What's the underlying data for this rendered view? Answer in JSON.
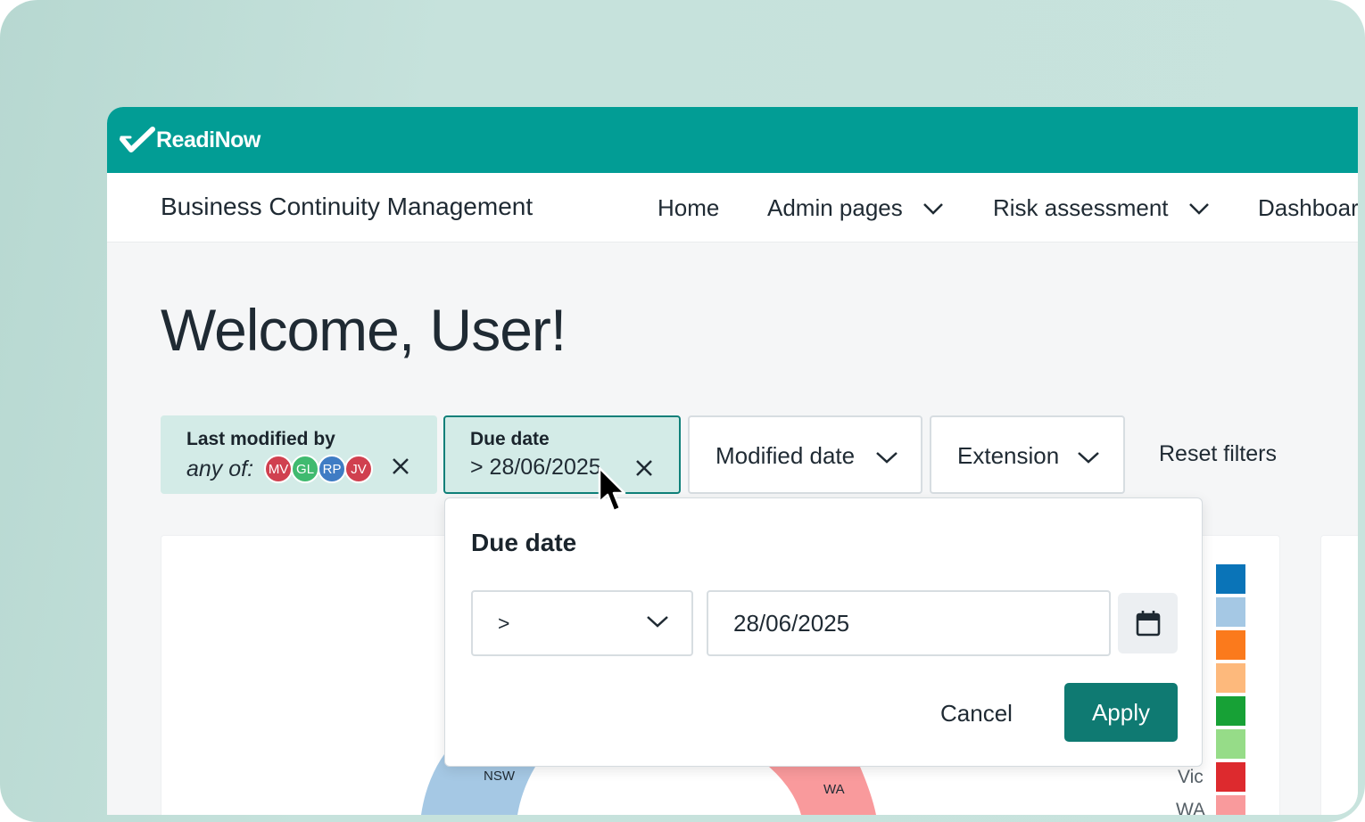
{
  "brand": {
    "name": "ReadiNow",
    "primary_color": "#029d95",
    "accent_color": "#0f7a72"
  },
  "app": {
    "title": "Business Continuity Management"
  },
  "nav": {
    "home": "Home",
    "admin": "Admin pages",
    "risk": "Risk assessment",
    "dashboard": "Dashboar"
  },
  "page": {
    "welcome": "Welcome, User!"
  },
  "filters": {
    "modified_by": {
      "title": "Last modified by",
      "qualifier": "any of:",
      "avatars": [
        {
          "initials": "MV",
          "color": "#d0404f"
        },
        {
          "initials": "GL",
          "color": "#3fba6f"
        },
        {
          "initials": "RP",
          "color": "#3f7cc4"
        },
        {
          "initials": "JV",
          "color": "#d0404f"
        }
      ]
    },
    "due_date": {
      "title": "Due date",
      "value": "> 28/06/2025"
    },
    "modified_date": {
      "label": "Modified date"
    },
    "extension": {
      "label": "Extension"
    },
    "reset": "Reset filters"
  },
  "popover": {
    "title": "Due date",
    "operator": ">",
    "date_value": "28/06/2025",
    "cancel": "Cancel",
    "apply": "Apply"
  },
  "chart": {
    "pie_labels": {
      "nsw": "NSW",
      "wa": "WA"
    },
    "legend": [
      {
        "label": "",
        "color": "#0a74b8"
      },
      {
        "label": "",
        "color": "#a5c8e4"
      },
      {
        "label": "",
        "color": "#fb7a1c"
      },
      {
        "label": "",
        "color": "#fdb97c"
      },
      {
        "label": "",
        "color": "#17a136"
      },
      {
        "label": "",
        "color": "#96dc88"
      },
      {
        "label": "Vic",
        "color": "#dd2a2e"
      },
      {
        "label": "WA",
        "color": "#f99a9c"
      }
    ]
  }
}
